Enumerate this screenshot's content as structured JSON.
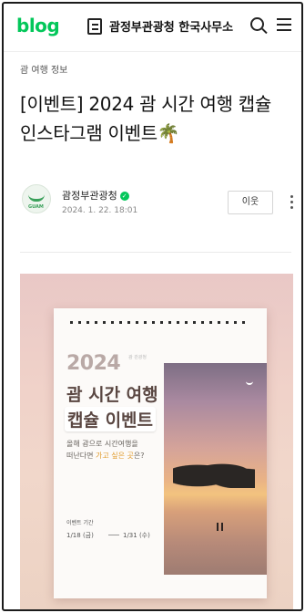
{
  "header": {
    "logo": "blog",
    "blog_title": "괌정부관광청 한국사무소"
  },
  "post": {
    "category": "괌 여행 정보",
    "title": "[이벤트] 2024 괌 시간 여행 캡슐 인스타그램 이벤트",
    "title_emoji": "🌴",
    "author": "괌정부관광청",
    "date": "2024. 1. 22. 18:01",
    "neighbor_button": "이웃",
    "avatar_tag": "GUAM"
  },
  "poster": {
    "year": "2024",
    "year_sub": "괌 관광청",
    "headline_1": "괌 시간 여행",
    "headline_2": "캡슐 이벤트",
    "desc_line1": "올해 괌으로 시간여행을",
    "desc_line2_a": "떠난다면 ",
    "desc_line2_hl": "가고 싶은 곳",
    "desc_line2_b": "은?",
    "period_label": "이벤트 기간",
    "date_start": "1/18 (금)",
    "date_end": "1/31 (수)"
  },
  "colors": {
    "brand_green": "#03c75a",
    "highlight": "#e09a2a"
  }
}
